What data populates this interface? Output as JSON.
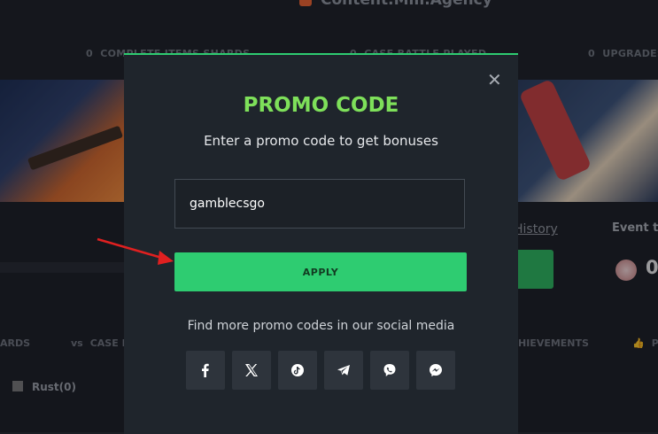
{
  "header": {
    "username": "Content.Mm.Agency"
  },
  "stats": [
    {
      "count": "0",
      "label": "COMPLETE ITEMS SHARDS"
    },
    {
      "count": "0",
      "label": "CASE BATTLE PLAYED"
    },
    {
      "count": "0",
      "label": "UPGRADES"
    }
  ],
  "background": {
    "history_link": "History",
    "event_label": "Event to",
    "event_value": "0",
    "tabs": [
      "ARDS",
      "CASE B",
      "HIEVEMENTS",
      "P"
    ],
    "rust_label": "Rust(0)"
  },
  "modal": {
    "title": "PROMO CODE",
    "subtitle": "Enter a promo code to get bonuses",
    "input_value": "gamblecsgo",
    "apply_label": "APPLY",
    "more_text": "Find more promo codes in our social media",
    "close_symbol": "✕",
    "social": [
      "facebook-icon",
      "x-icon",
      "tiktok-icon",
      "telegram-icon",
      "viber-icon",
      "messenger-icon"
    ]
  },
  "colors": {
    "accent_green": "#2ecc71",
    "title_green": "#7ee05a",
    "modal_bg": "#1f252c",
    "arrow_red": "#e02020"
  }
}
